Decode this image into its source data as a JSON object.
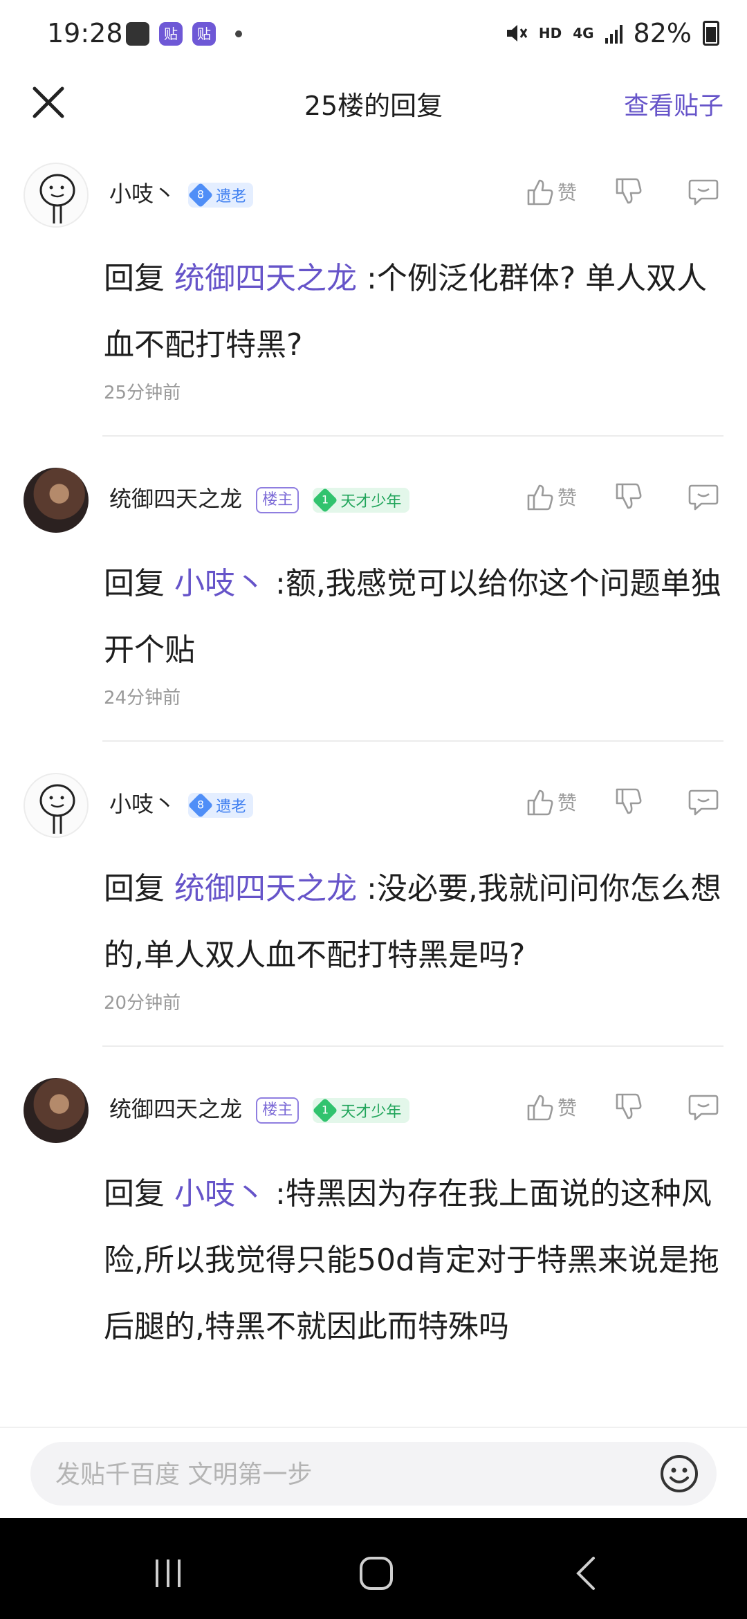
{
  "status_bar": {
    "time": "19:28",
    "network": "HD",
    "signal": "4G",
    "battery": "82%"
  },
  "header": {
    "title": "25楼的回复",
    "view_post": "查看贴子"
  },
  "comments": [
    {
      "username": "小吱丶",
      "level": "8",
      "level_title": "遗老",
      "owner_badge": "",
      "reply_prefix": "回复",
      "reply_to": "统御四天之龙",
      "text": ":个例泛化群体? 单人双人血不配打特黑?",
      "time_ago": "25分钟前",
      "like_label": "赞"
    },
    {
      "username": "统御四天之龙",
      "level": "1",
      "level_title": "天才少年",
      "owner_badge": "楼主",
      "reply_prefix": "回复",
      "reply_to": "小吱丶",
      "text": ":额,我感觉可以给你这个问题单独开个贴",
      "time_ago": "24分钟前",
      "like_label": "赞"
    },
    {
      "username": "小吱丶",
      "level": "8",
      "level_title": "遗老",
      "owner_badge": "",
      "reply_prefix": "回复",
      "reply_to": "统御四天之龙",
      "text": ":没必要,我就问问你怎么想的,单人双人血不配打特黑是吗?",
      "time_ago": "20分钟前",
      "like_label": "赞"
    },
    {
      "username": "统御四天之龙",
      "level": "1",
      "level_title": "天才少年",
      "owner_badge": "楼主",
      "reply_prefix": "回复",
      "reply_to": "小吱丶",
      "text": ":特黑因为存在我上面说的这种风险,所以我觉得只能50d肯定对于特黑来说是拖后腿的,特黑不就因此而特殊吗",
      "time_ago": "",
      "like_label": "赞"
    }
  ],
  "input": {
    "placeholder": "发贴千百度 文明第一步"
  },
  "colors": {
    "accent": "#6654c9",
    "level_blue": "#4f8ef7",
    "level_green": "#31c36e",
    "muted": "#9a9a9a"
  },
  "icons": [
    "close-icon",
    "thumbs-up-icon",
    "thumbs-down-icon",
    "comment-icon",
    "emoji-icon",
    "recent-apps-icon",
    "home-icon",
    "back-icon"
  ]
}
